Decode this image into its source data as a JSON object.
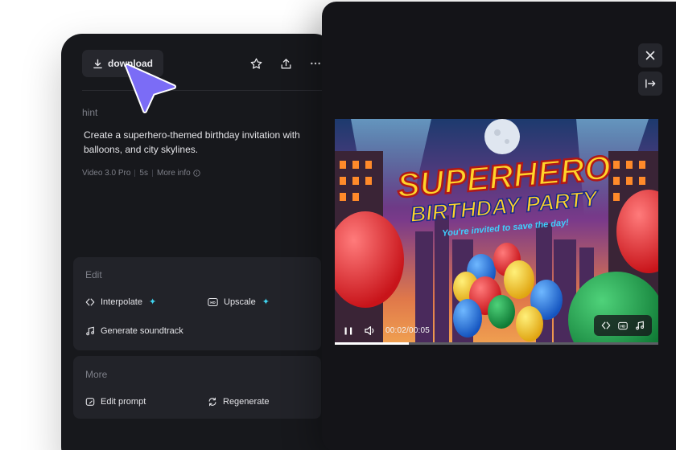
{
  "toolbar": {
    "download_label": "download",
    "icons": [
      "download-icon",
      "star-icon",
      "share-icon",
      "more-icon"
    ]
  },
  "details": {
    "hint_label": "hint",
    "prompt": "Create a superhero-themed birthday invitation with balloons, and city skylines.",
    "model": "Video 3.0 Pro",
    "duration": "5s",
    "more_info": "More info"
  },
  "edit_card": {
    "title": "Edit",
    "interpolate": "Interpolate",
    "upscale": "Upscale",
    "soundtrack": "Generate soundtrack"
  },
  "more_card": {
    "title": "More",
    "edit_prompt": "Edit prompt",
    "regenerate": "Regenerate"
  },
  "player": {
    "time": "00:02/00:05",
    "progress": 0.23,
    "video_title_line1": "SUPERHERO",
    "video_title_line2": "BIRTHDAY PARTY",
    "video_tagline": "You're invited to save the day!"
  },
  "colors": {
    "accent_sparkle": "#3fd4f0",
    "cursor": "#7b6cf6",
    "panel": "#17181c"
  }
}
